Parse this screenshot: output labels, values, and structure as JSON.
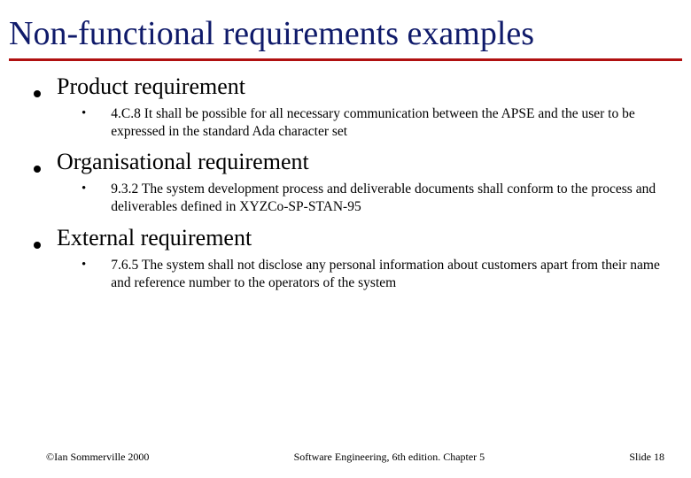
{
  "title": "Non-functional requirements examples",
  "items": [
    {
      "heading": "Product requirement",
      "detail": "4.C.8 It shall be possible for all necessary communication between the APSE and the user to be expressed in the standard Ada character set"
    },
    {
      "heading": "Organisational requirement",
      "detail": "9.3.2  The system development process and deliverable documents shall conform to the process and deliverables defined in XYZCo-SP-STAN-95"
    },
    {
      "heading": "External requirement",
      "detail": "7.6.5  The system shall not disclose any personal information about customers apart from their name and reference number to the operators of the system"
    }
  ],
  "footer": {
    "copyright": "©Ian Sommerville 2000",
    "center": "Software Engineering, 6th edition. Chapter 5",
    "slide": "Slide  18"
  }
}
